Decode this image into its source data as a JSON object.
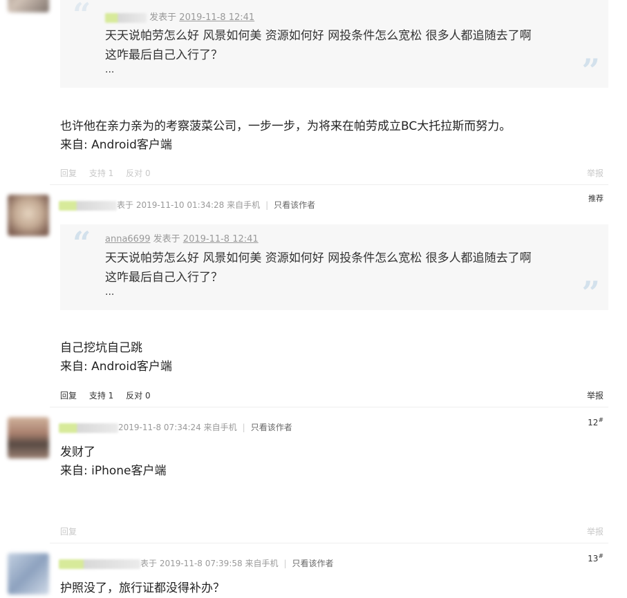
{
  "posts": [
    {
      "quote": {
        "author": "",
        "posted_prefix": "发表于",
        "date": "2019-11-8 12:41",
        "lines": [
          "天天说帕劳怎么好 风景如何美 资源如何好 网投条件怎么宽松 很多人都追随去了啊",
          "这咋最后自己入行了？",
          "..."
        ]
      },
      "body": [
        "也许他在亲力亲为的考察菠菜公司，一步一步，为将来在帕劳成立BC大托拉斯而努力。",
        "来自: Android客户端"
      ],
      "actions": {
        "reply": "回复",
        "support": "支持 1",
        "oppose": "反对 0",
        "report": "举报"
      }
    },
    {
      "header": {
        "posted": "表于 2019-11-10 01:34:28 来自手机",
        "only_author": "只看该作者"
      },
      "badge": "推荐",
      "quote": {
        "author": "anna6699",
        "posted_prefix": "发表于",
        "date": "2019-11-8 12:41",
        "lines": [
          "天天说帕劳怎么好 风景如何美 资源如何好 网投条件怎么宽松 很多人都追随去了啊",
          "这咋最后自己入行了？",
          "..."
        ]
      },
      "body": [
        "自己挖坑自己跳",
        "来自: Android客户端"
      ],
      "actions": {
        "reply": "回复",
        "support": "支持 1",
        "oppose": "反对 0",
        "report": "举报"
      }
    },
    {
      "header": {
        "posted": "2019-11-8 07:34:24 来自手机",
        "only_author": "只看该作者"
      },
      "floor": "12",
      "floor_mark": "#",
      "body": [
        "发财了",
        "来自: iPhone客户端"
      ],
      "actions": {
        "reply": "回复",
        "report": "举报"
      }
    },
    {
      "header": {
        "posted": "表于 2019-11-8 07:39:58 来自手机",
        "only_author": "只看该作者"
      },
      "floor": "13",
      "floor_mark": "#",
      "body": [
        "护照没了，旅行证都没得补办？"
      ]
    }
  ],
  "icons": {
    "quote_open": "open-quote-icon",
    "quote_close": "close-quote-icon"
  },
  "colors": {
    "quote_bg": "#f7f7f7",
    "quote_mark": "#d3e1ec",
    "muted": "#999999"
  }
}
